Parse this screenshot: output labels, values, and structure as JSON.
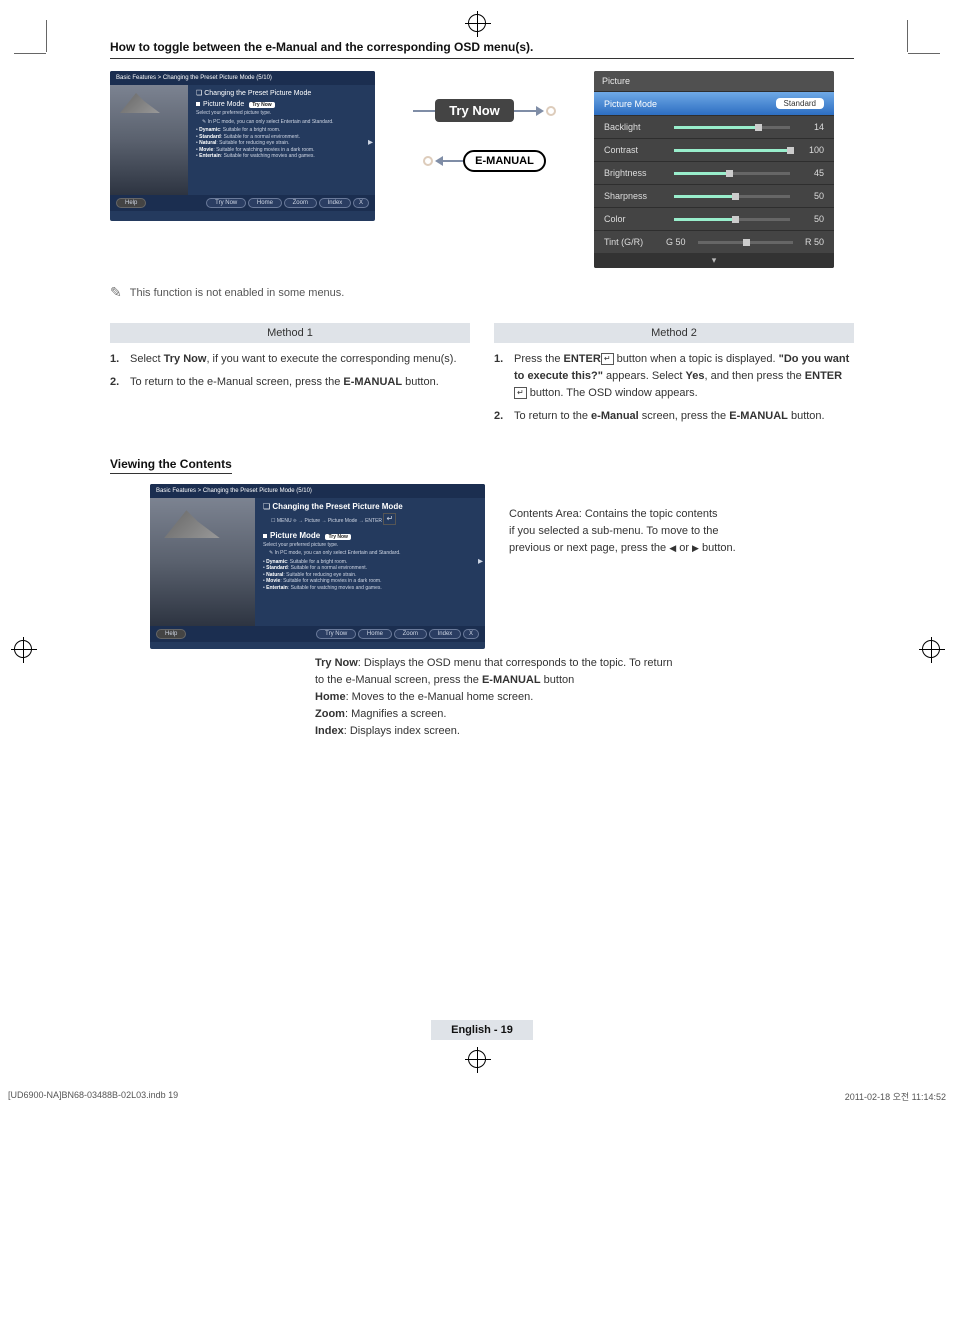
{
  "section_title": "How to toggle between the e-Manual and the corresponding OSD menu(s).",
  "emanual_small": {
    "breadcrumb": "Basic Features > Changing the Preset Picture Mode (5/10)",
    "heading": "Changing the Preset Picture Mode",
    "picture_mode_label": "Picture Mode",
    "try_now_tag": "Try Now",
    "select_text": "Select your preferred picture type.",
    "pc_note": "In PC mode, you can only select Entertain and Standard.",
    "bullets": [
      {
        "b": "Dynamic",
        "t": ": Suitable for a bright room."
      },
      {
        "b": "Standard",
        "t": ": Suitable for a normal environment."
      },
      {
        "b": "Natural",
        "t": ": Suitable for reducing eye strain."
      },
      {
        "b": "Movie",
        "t": ": Suitable for watching movies in a dark room."
      },
      {
        "b": "Entertain",
        "t": ": Suitable for watching movies and games."
      }
    ],
    "footer": {
      "help": "Help",
      "try_now": "Try Now",
      "home": "Home",
      "zoom": "Zoom",
      "index": "Index",
      "close": "X"
    }
  },
  "arrows": {
    "try_now": "Try Now",
    "emanual": "E-MANUAL"
  },
  "osd": {
    "title": "Picture",
    "active": {
      "label": "Picture Mode",
      "value": "Standard"
    },
    "rows": [
      {
        "label": "Backlight",
        "value": "14",
        "fill": 70
      },
      {
        "label": "Contrast",
        "value": "100",
        "fill": 100
      },
      {
        "label": "Brightness",
        "value": "45",
        "fill": 45
      },
      {
        "label": "Sharpness",
        "value": "50",
        "fill": 50
      },
      {
        "label": "Color",
        "value": "50",
        "fill": 50
      }
    ],
    "tint": {
      "label": "Tint (G/R)",
      "left": "G 50",
      "right": "R 50"
    }
  },
  "note_text": "This function is not enabled in some menus.",
  "methods": {
    "m1_title": "Method 1",
    "m2_title": "Method 2",
    "m1_steps": [
      {
        "n": "1.",
        "pre": "Select ",
        "b1": "Try Now",
        "post": ", if you want to execute the corresponding menu(s)."
      },
      {
        "n": "2.",
        "pre": "To return to the e-Manual screen, press the ",
        "b1": "E-MANUAL",
        "post": " button."
      }
    ],
    "m2_steps": [
      {
        "n": "1.",
        "text_a": "Press the ",
        "b1": "ENTER",
        "text_b": " button when a topic is displayed. ",
        "q": "\"Do you want to execute this?\"",
        "text_c": " appears. Select ",
        "b2": "Yes",
        "text_d": ", and then press the ",
        "b3": "ENTER",
        "text_e": " button. The OSD window appears."
      },
      {
        "n": "2.",
        "text_a": "To return to the ",
        "b1": "e-Manual",
        "text_b": " screen, press the ",
        "b2": "E-MANUAL",
        "text_c": " button."
      }
    ]
  },
  "viewing_heading": "Viewing the Contents",
  "content_panel": {
    "breadcrumb": "Basic Features > Changing the Preset Picture Mode (5/10)",
    "heading": "Changing the Preset Picture Mode",
    "menu_path": "MENU ⯐ → Picture → Picture Mode → ENTER",
    "picture_mode_label": "Picture Mode",
    "try_now_tag": "Try Now",
    "select_text": "Select your preferred picture type.",
    "pc_note": "In PC mode, you can only select Entertain and Standard.",
    "bullets": [
      {
        "b": "Dynamic",
        "t": ": Suitable for a bright room."
      },
      {
        "b": "Standard",
        "t": ": Suitable for a normal environment."
      },
      {
        "b": "Natural",
        "t": ": Suitable for reducing eye strain."
      },
      {
        "b": "Movie",
        "t": ": Suitable for watching movies in a dark room."
      },
      {
        "b": "Entertain",
        "t": ": Suitable for watching movies and games."
      }
    ],
    "footer": {
      "help": "Help",
      "try_now": "Try Now",
      "home": "Home",
      "zoom": "Zoom",
      "index": "Index",
      "close": "X"
    }
  },
  "content_desc": {
    "l1": "Contents Area: Contains the topic contents",
    "l2": "if you selected a sub-menu. To move to the",
    "l3_pre": "previous or next page, press the ",
    "l3_mid": " or ",
    "l3_post": " button."
  },
  "captions": {
    "try_now_b": "Try Now",
    "try_now_t": ": Displays the OSD menu that corresponds to the topic. To return",
    "try_now_t2_pre": "to the e-Manual screen, press the ",
    "try_now_t2_b": "E-MANUAL",
    "try_now_t2_post": " button",
    "home_b": "Home",
    "home_t": ": Moves to the e-Manual home screen.",
    "zoom_b": "Zoom",
    "zoom_t": ": Magnifies a screen.",
    "index_b": "Index",
    "index_t": ": Displays index screen."
  },
  "footer": {
    "lang": "English - 19"
  },
  "filestamp": {
    "left": "[UD6900-NA]BN68-03488B-02L03.indb   19",
    "right": "2011-02-18   오전 11:14:52"
  }
}
